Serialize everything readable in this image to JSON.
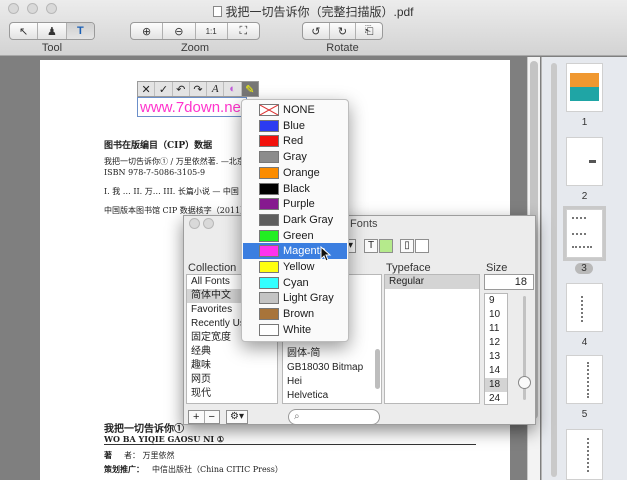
{
  "window": {
    "title": "我把一切告诉你（完整扫描版）.pdf"
  },
  "toolbar": {
    "tool_label": "Tool",
    "zoom_label": "Zoom",
    "rotate_label": "Rotate",
    "tool_buttons": [
      "select-arrow",
      "stamp",
      "T"
    ],
    "zoom_buttons": [
      "zoom-in",
      "zoom-out",
      "1:1",
      "fit"
    ],
    "rotate_buttons": [
      "rotate-left",
      "rotate-right",
      "print"
    ]
  },
  "annotation_toolbar": {
    "buttons": [
      "✕",
      "✓",
      "↶",
      "↷",
      "A",
      "◐",
      "✎"
    ]
  },
  "textbox": {
    "text": "www.7down.ne"
  },
  "document": {
    "cip_title": "图书在版编目（CIP）数据",
    "cip_line1": "我把一切告诉你① / 万里依然著. —北京:",
    "cip_line2": "ISBN 978-7-5086-3105-9",
    "cip_line3": "I. 我 …   II. 万…   III. 长篇小说 — 中国 —",
    "cip_line4": "中国版本图书馆 CIP 数据核字（2011）第3",
    "book_title": "我把一切告诉你①",
    "book_pinyin": "WO BA YIQIE GAOSU NI ①",
    "author_label": "著",
    "author_value": "者：  万里依然",
    "publisher_label": "策划推广：",
    "publisher_value": "中信出版社（China CITIC Press）"
  },
  "fonts_panel": {
    "title": "Fonts",
    "collection_header": "Collection",
    "typeface_header": "Typeface",
    "size_header": "Size",
    "size_value": "18",
    "collections": [
      "All Fonts",
      "简体中文",
      "Favorites",
      "Recently Used",
      "固定宽度",
      "经典",
      "趣味",
      "网页",
      "现代"
    ],
    "families": [
      "圆体-简",
      "GB18030 Bitmap",
      "Hei",
      "Helvetica"
    ],
    "typefaces": [
      "Regular"
    ],
    "sizes": [
      "9",
      "10",
      "11",
      "12",
      "13",
      "14",
      "18",
      "24"
    ],
    "add_label": "+",
    "remove_label": "−",
    "gear_label": "⚙▾"
  },
  "color_menu": {
    "items": [
      {
        "label": "NONE",
        "color": "none"
      },
      {
        "label": "Blue",
        "color": "#2b3bf0"
      },
      {
        "label": "Red",
        "color": "#f2110c"
      },
      {
        "label": "Gray",
        "color": "#8c8c8c"
      },
      {
        "label": "Orange",
        "color": "#fb8c00"
      },
      {
        "label": "Black",
        "color": "#000000"
      },
      {
        "label": "Purple",
        "color": "#86198f"
      },
      {
        "label": "Dark Gray",
        "color": "#5e5e5e"
      },
      {
        "label": "Green",
        "color": "#22ee22"
      },
      {
        "label": "Magenta",
        "color": "#ff33ee"
      },
      {
        "label": "Yellow",
        "color": "#ffff10"
      },
      {
        "label": "Cyan",
        "color": "#33ffff"
      },
      {
        "label": "Light Gray",
        "color": "#c4c4c4"
      },
      {
        "label": "Brown",
        "color": "#a8743a"
      },
      {
        "label": "White",
        "color": "#ffffff"
      }
    ],
    "highlighted": "Magenta"
  },
  "thumbnails": {
    "pages": [
      "1",
      "2",
      "3",
      "4",
      "5"
    ],
    "selected": "3"
  }
}
